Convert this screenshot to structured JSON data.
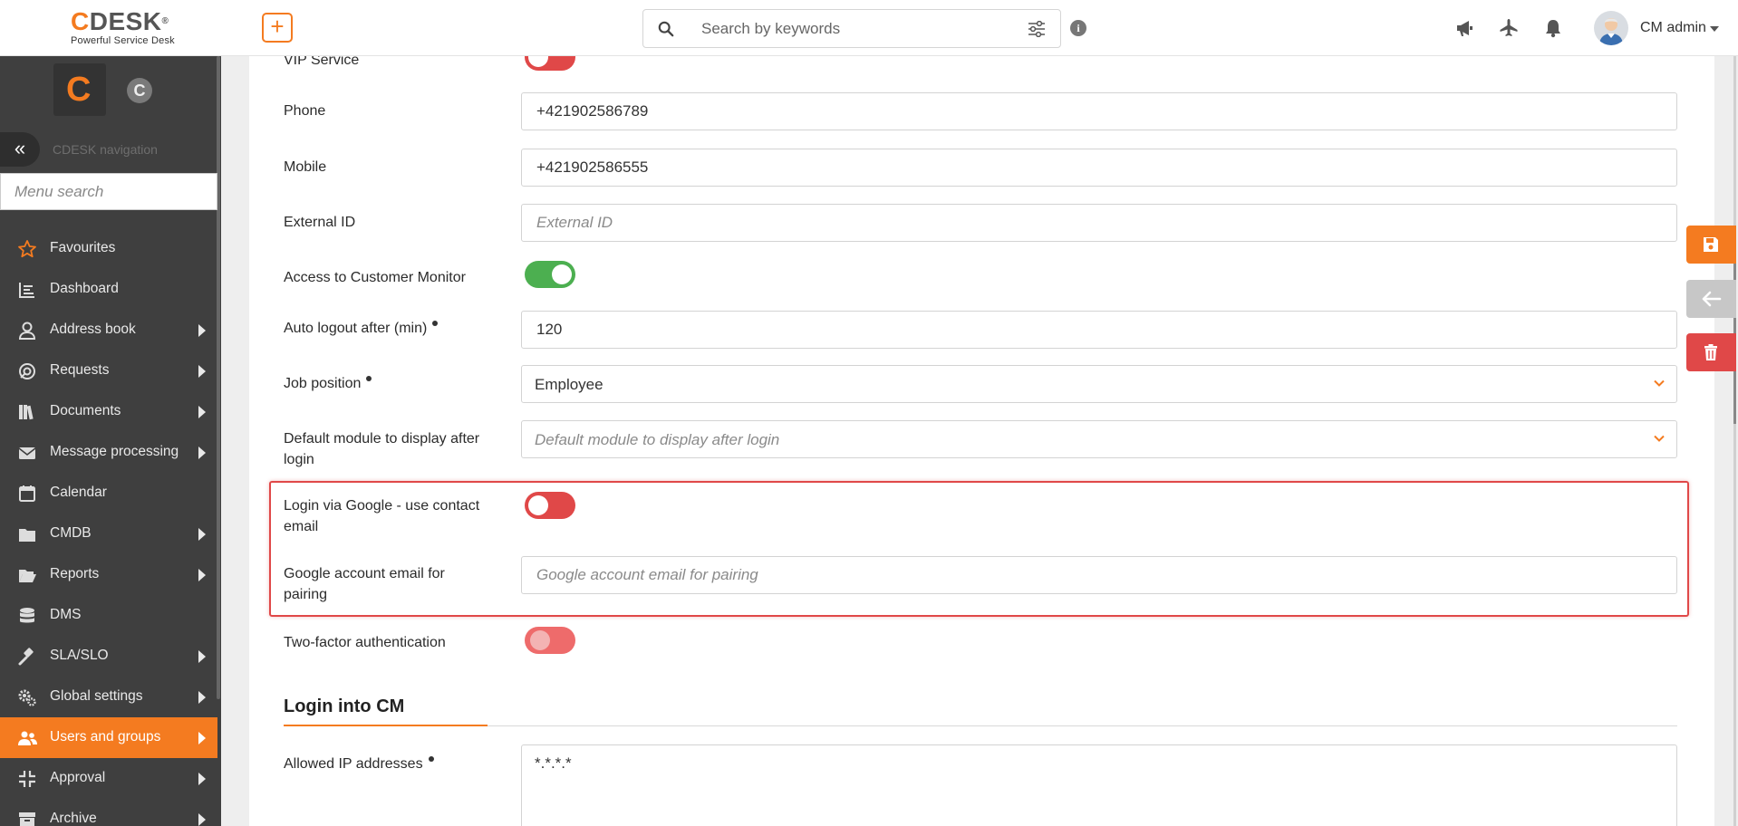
{
  "header": {
    "logo_text": "CDESK",
    "logo_tagline": "Powerful Service Desk",
    "add_label": "+",
    "search_placeholder": "Search by keywords",
    "info_label": "i",
    "user_name": "CM admin"
  },
  "sidebar": {
    "module_label": "C",
    "nav_title": "CDESK navigation",
    "menu_search_placeholder": "Menu search",
    "items": [
      {
        "label": "Favourites",
        "icon": "star-icon",
        "has_submenu": false,
        "active": false
      },
      {
        "label": "Dashboard",
        "icon": "dashboard-icon",
        "has_submenu": false,
        "active": false
      },
      {
        "label": "Address book",
        "icon": "person-icon",
        "has_submenu": true,
        "active": false
      },
      {
        "label": "Requests",
        "icon": "requests-icon",
        "has_submenu": true,
        "active": false
      },
      {
        "label": "Documents",
        "icon": "books-icon",
        "has_submenu": true,
        "active": false
      },
      {
        "label": "Message processing",
        "icon": "envelope-icon",
        "has_submenu": true,
        "active": false
      },
      {
        "label": "Calendar",
        "icon": "calendar-icon",
        "has_submenu": false,
        "active": false
      },
      {
        "label": "CMDB",
        "icon": "folder-icon",
        "has_submenu": true,
        "active": false
      },
      {
        "label": "Reports",
        "icon": "folder-open-icon",
        "has_submenu": true,
        "active": false
      },
      {
        "label": "DMS",
        "icon": "database-icon",
        "has_submenu": false,
        "active": false
      },
      {
        "label": "SLA/SLO",
        "icon": "gavel-icon",
        "has_submenu": true,
        "active": false
      },
      {
        "label": "Global settings",
        "icon": "gears-icon",
        "has_submenu": true,
        "active": false
      },
      {
        "label": "Users and groups",
        "icon": "users-icon",
        "has_submenu": true,
        "active": true
      },
      {
        "label": "Approval",
        "icon": "approval-icon",
        "has_submenu": true,
        "active": false
      },
      {
        "label": "Archive",
        "icon": "archive-icon",
        "has_submenu": true,
        "active": false
      }
    ]
  },
  "form": {
    "vip_service": {
      "label": "VIP Service",
      "state": "off"
    },
    "phone": {
      "label": "Phone",
      "value": "+421902586789"
    },
    "mobile": {
      "label": "Mobile",
      "value": "+421902586555"
    },
    "external_id": {
      "label": "External ID",
      "value": "",
      "placeholder": "External ID"
    },
    "access_customer_monitor": {
      "label": "Access to Customer Monitor",
      "state": "on"
    },
    "auto_logout": {
      "label": "Auto logout after (min)",
      "value": "120",
      "required": true
    },
    "job_position": {
      "label": "Job position",
      "value": "Employee",
      "required": true
    },
    "default_module": {
      "label": "Default module to display after login",
      "value": "",
      "placeholder": "Default module to display after login"
    },
    "login_google": {
      "label": "Login via Google - use contact email",
      "state": "off"
    },
    "google_email": {
      "label": "Google account email for pairing",
      "value": "",
      "placeholder": "Google account email for pairing"
    },
    "two_factor": {
      "label": "Two-factor authentication",
      "state": "off"
    },
    "section_login_cm": "Login into CM",
    "allowed_ip": {
      "label": "Allowed IP addresses",
      "value": "*.*.*.*",
      "required": true
    }
  },
  "colors": {
    "accent": "#f47b20",
    "sidebar_bg": "#3f3f3f",
    "toggle_on": "#4caf50",
    "toggle_off": "#e04848",
    "highlight_border": "#e04848"
  }
}
